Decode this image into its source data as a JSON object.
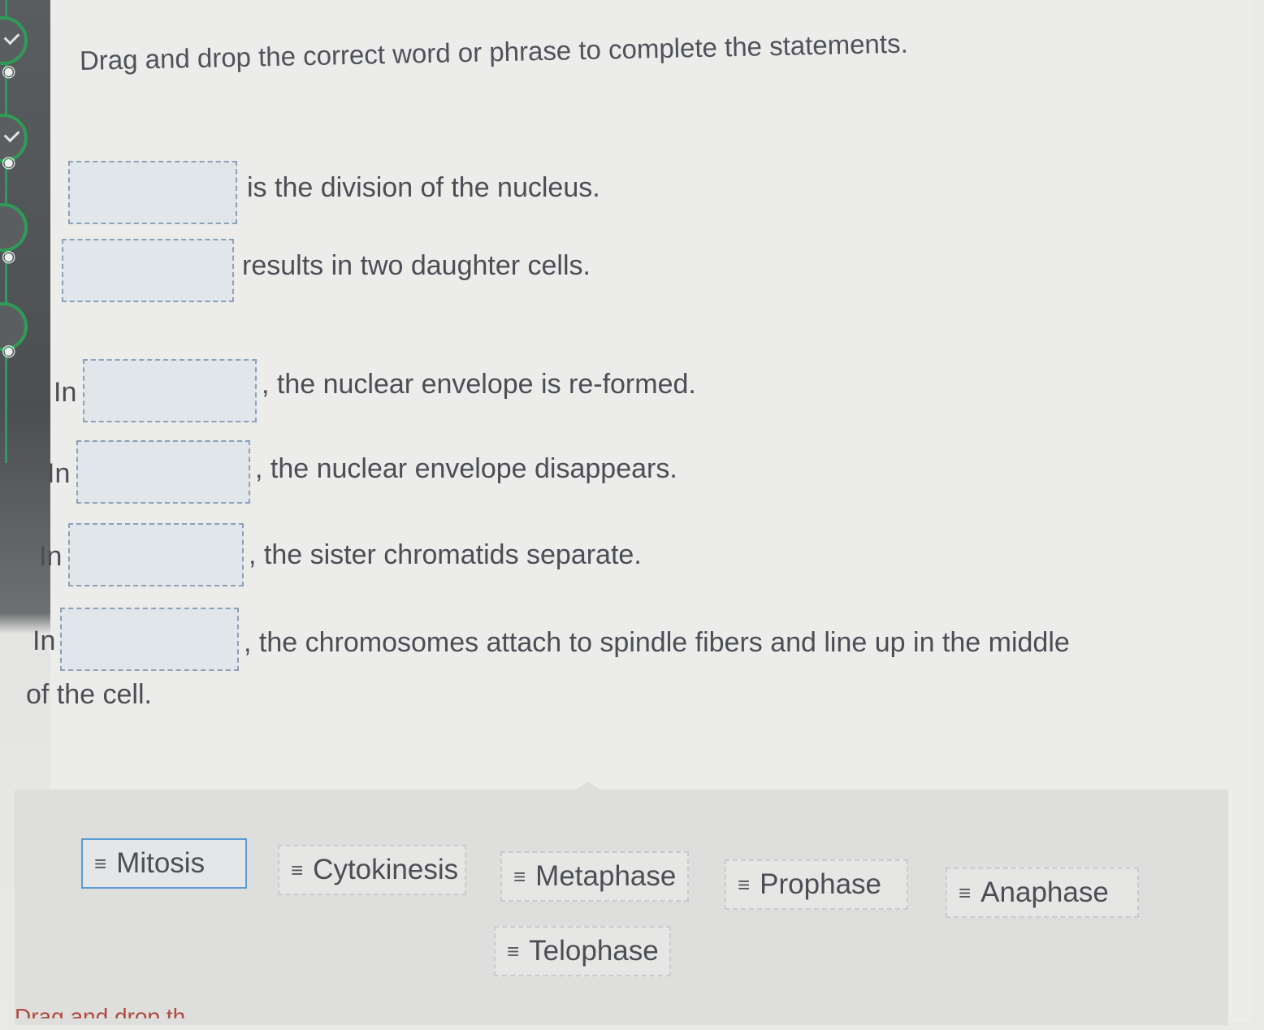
{
  "instruction": "Drag and drop the correct word or phrase to complete the statements.",
  "statements": [
    {
      "prefix": "",
      "suffix": "is the division of the nucleus.",
      "continuation": ""
    },
    {
      "prefix": "",
      "suffix": "results in two daughter cells.",
      "continuation": ""
    },
    {
      "prefix": "In",
      "suffix": ", the nuclear envelope is re-formed.",
      "continuation": ""
    },
    {
      "prefix": "In",
      "suffix": ", the nuclear envelope disappears.",
      "continuation": ""
    },
    {
      "prefix": "In",
      "suffix": ", the sister chromatids separate.",
      "continuation": ""
    },
    {
      "prefix": "In",
      "suffix": ", the chromosomes attach to spindle fibers and line up in the middle",
      "continuation": "of the cell."
    }
  ],
  "word_bank": {
    "grip_glyph": "≡",
    "options": [
      {
        "label": "Mitosis",
        "selected": true
      },
      {
        "label": "Cytokinesis",
        "selected": false
      },
      {
        "label": "Metaphase",
        "selected": false
      },
      {
        "label": "Prophase",
        "selected": false
      },
      {
        "label": "Anaphase",
        "selected": false
      },
      {
        "label": "Telophase",
        "selected": false
      }
    ]
  },
  "footer_text": "Drag and drop th",
  "sidebar_icons": [
    "check-icon",
    "hidden-eye-icon",
    "check-icon",
    "eye-icon",
    "hidden-eye-icon"
  ],
  "colors": {
    "accent": "#2f9b57",
    "selected_border": "#5b9bd5",
    "drop_zone": "#e1e6ea"
  }
}
